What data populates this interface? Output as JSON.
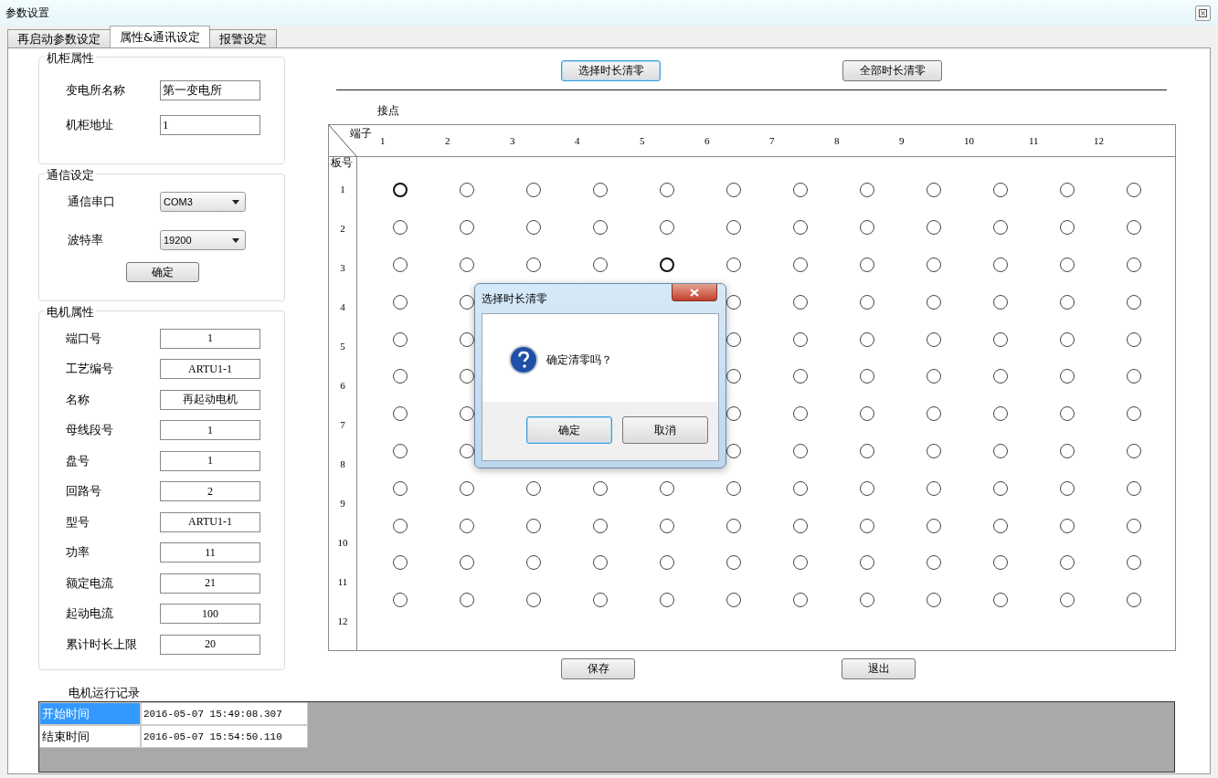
{
  "window": {
    "title": "参数设置"
  },
  "tabs": [
    {
      "label": "再启动参数设定",
      "selected": false
    },
    {
      "label": "属性&通讯设定",
      "selected": true
    },
    {
      "label": "报警设定",
      "selected": false
    }
  ],
  "cabinet": {
    "title": "机柜属性",
    "fields": [
      {
        "label": "变电所名称",
        "value": "第一变电所"
      },
      {
        "label": "机柜地址",
        "value": "1"
      }
    ]
  },
  "comm": {
    "title": "通信设定",
    "fields": [
      {
        "label": "通信串口",
        "value": "COM3"
      },
      {
        "label": "波特率",
        "value": "19200"
      }
    ],
    "button": "确定"
  },
  "motor": {
    "title": "电机属性",
    "fields": [
      {
        "label": "端口号",
        "value": "1"
      },
      {
        "label": "工艺编号",
        "value": "ARTU1-1"
      },
      {
        "label": "名称",
        "value": "再起动电机"
      },
      {
        "label": "母线段号",
        "value": "1"
      },
      {
        "label": "盘号",
        "value": "1"
      },
      {
        "label": "回路号",
        "value": "2"
      },
      {
        "label": "型号",
        "value": "ARTU1-1"
      },
      {
        "label": "功率",
        "value": "11"
      },
      {
        "label": "额定电流",
        "value": "21"
      },
      {
        "label": "起动电流",
        "value": "100"
      },
      {
        "label": "累计时长上限",
        "value": "20"
      }
    ]
  },
  "top_buttons": [
    {
      "label": "选择时长清零",
      "focused": true
    },
    {
      "label": "全部时长清零",
      "focused": false
    }
  ],
  "grid": {
    "title": "接点",
    "column_header": "端子",
    "row_header": "板号",
    "columns": [
      "1",
      "2",
      "3",
      "4",
      "5",
      "6",
      "7",
      "8",
      "9",
      "10",
      "11",
      "12"
    ],
    "row_labels": [
      "1",
      "2",
      "3",
      "4",
      "5",
      "6",
      "7",
      "8",
      "9",
      "10",
      "11",
      "12"
    ],
    "rows": [
      [
        {
          "selected": true
        },
        {
          "selected": false
        },
        {
          "selected": false
        },
        {
          "selected": false
        },
        {
          "selected": false
        },
        {
          "selected": false
        },
        {
          "selected": false
        },
        {
          "selected": false
        },
        {
          "selected": false
        },
        {
          "selected": false
        },
        {
          "selected": false
        },
        {
          "selected": false
        }
      ],
      [
        {
          "selected": false
        },
        {
          "selected": false
        },
        {
          "selected": false
        },
        {
          "selected": false
        },
        {
          "selected": false
        },
        {
          "selected": false
        },
        {
          "selected": false
        },
        {
          "selected": false
        },
        {
          "selected": false
        },
        {
          "selected": false
        },
        {
          "selected": false
        },
        {
          "selected": false
        }
      ],
      [
        {
          "selected": false
        },
        {
          "selected": false
        },
        {
          "selected": false
        },
        {
          "selected": false
        },
        {
          "selected": true
        },
        {
          "selected": false
        },
        {
          "selected": false
        },
        {
          "selected": false
        },
        {
          "selected": false
        },
        {
          "selected": false
        },
        {
          "selected": false
        },
        {
          "selected": false
        }
      ],
      [
        {
          "selected": false
        },
        {
          "selected": false
        },
        null,
        null,
        null,
        {
          "selected": false
        },
        {
          "selected": false
        },
        {
          "selected": false
        },
        {
          "selected": false
        },
        {
          "selected": false
        },
        {
          "selected": false
        },
        {
          "selected": false
        }
      ],
      [
        {
          "selected": false
        },
        {
          "selected": false
        },
        null,
        null,
        null,
        {
          "selected": false
        },
        {
          "selected": false
        },
        {
          "selected": false
        },
        {
          "selected": false
        },
        {
          "selected": false
        },
        {
          "selected": false
        },
        {
          "selected": false
        }
      ],
      [
        {
          "selected": false
        },
        {
          "selected": false
        },
        null,
        null,
        null,
        {
          "selected": false
        },
        {
          "selected": false
        },
        {
          "selected": false
        },
        {
          "selected": false
        },
        {
          "selected": false
        },
        {
          "selected": false
        },
        {
          "selected": false
        }
      ],
      [
        {
          "selected": false
        },
        {
          "selected": false
        },
        null,
        null,
        null,
        {
          "selected": false
        },
        {
          "selected": false
        },
        {
          "selected": false
        },
        {
          "selected": false
        },
        {
          "selected": false
        },
        {
          "selected": false
        },
        {
          "selected": false
        }
      ],
      [
        {
          "selected": false
        },
        {
          "selected": false
        },
        null,
        null,
        null,
        {
          "selected": false
        },
        {
          "selected": false
        },
        {
          "selected": false
        },
        {
          "selected": false
        },
        {
          "selected": false
        },
        {
          "selected": false
        },
        {
          "selected": false
        }
      ],
      [
        {
          "selected": false
        },
        {
          "selected": false
        },
        {
          "selected": false
        },
        {
          "selected": false
        },
        {
          "selected": false
        },
        {
          "selected": false
        },
        {
          "selected": false
        },
        {
          "selected": false
        },
        {
          "selected": false
        },
        {
          "selected": false
        },
        {
          "selected": false
        },
        {
          "selected": false
        }
      ],
      [
        {
          "selected": false
        },
        {
          "selected": false
        },
        {
          "selected": false
        },
        {
          "selected": false
        },
        {
          "selected": false
        },
        {
          "selected": false
        },
        {
          "selected": false
        },
        {
          "selected": false
        },
        {
          "selected": false
        },
        {
          "selected": false
        },
        {
          "selected": false
        },
        {
          "selected": false
        }
      ],
      [
        {
          "selected": false
        },
        {
          "selected": false
        },
        {
          "selected": false
        },
        {
          "selected": false
        },
        {
          "selected": false
        },
        {
          "selected": false
        },
        {
          "selected": false
        },
        {
          "selected": false
        },
        {
          "selected": false
        },
        {
          "selected": false
        },
        {
          "selected": false
        },
        {
          "selected": false
        }
      ],
      [
        {
          "selected": false
        },
        {
          "selected": false
        },
        {
          "selected": false
        },
        {
          "selected": false
        },
        {
          "selected": false
        },
        {
          "selected": false
        },
        {
          "selected": false
        },
        {
          "selected": false
        },
        {
          "selected": false
        },
        {
          "selected": false
        },
        {
          "selected": false
        },
        {
          "selected": false
        }
      ]
    ]
  },
  "bottom_buttons": [
    {
      "label": "保存",
      "focused": false
    },
    {
      "label": "退出",
      "focused": false
    }
  ],
  "record": {
    "title": "电机运行记录",
    "rows": [
      {
        "label": "开始时间",
        "value": "2016-05-07 15:49:08.307",
        "selected": true
      },
      {
        "label": "结束时间",
        "value": "2016-05-07 15:54:50.110",
        "selected": false
      }
    ]
  },
  "dialog": {
    "title": "选择时长清零",
    "message": "确定清零吗？",
    "buttons": [
      {
        "label": "确定",
        "focused": true
      },
      {
        "label": "取消",
        "focused": false
      }
    ]
  }
}
